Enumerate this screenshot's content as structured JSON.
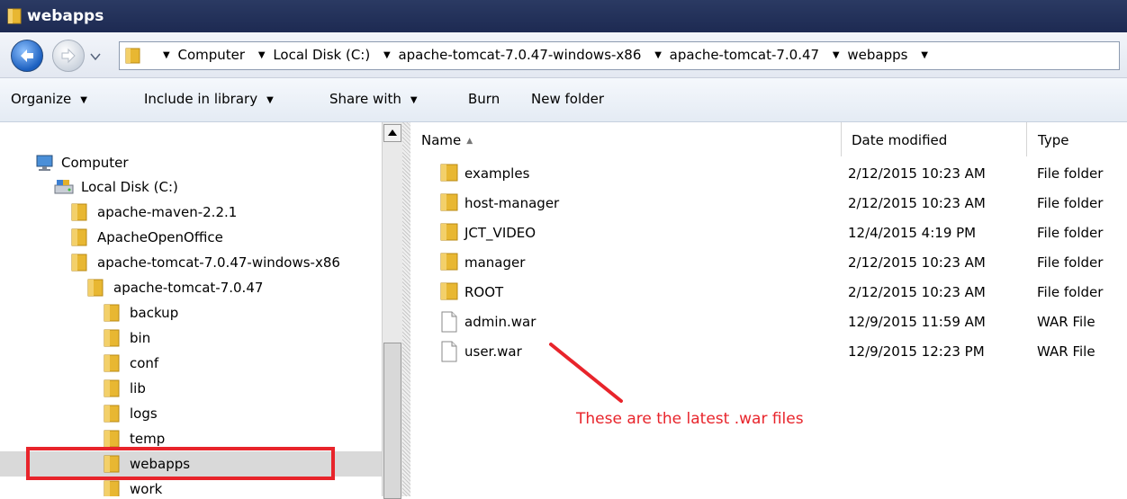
{
  "window": {
    "title": "webapps"
  },
  "address_bar": {
    "crumbs": [
      "Computer",
      "Local Disk (C:)",
      "apache-tomcat-7.0.47-windows-x86",
      "apache-tomcat-7.0.47",
      "webapps"
    ]
  },
  "toolbar": {
    "organize": "Organize",
    "include_in_library": "Include in library",
    "share_with": "Share with",
    "burn": "Burn",
    "new_folder": "New folder"
  },
  "tree": {
    "items": [
      {
        "label": "Computer",
        "icon": "computer-icon"
      },
      {
        "label": "Local Disk (C:)",
        "icon": "drive-icon"
      },
      {
        "label": "apache-maven-2.2.1",
        "icon": "folder-icon"
      },
      {
        "label": "ApacheOpenOffice",
        "icon": "folder-icon"
      },
      {
        "label": "apache-tomcat-7.0.47-windows-x86",
        "icon": "folder-icon"
      },
      {
        "label": "apache-tomcat-7.0.47",
        "icon": "folder-icon"
      },
      {
        "label": "backup",
        "icon": "folder-icon"
      },
      {
        "label": "bin",
        "icon": "folder-icon"
      },
      {
        "label": "conf",
        "icon": "folder-icon"
      },
      {
        "label": "lib",
        "icon": "folder-icon"
      },
      {
        "label": "logs",
        "icon": "folder-icon"
      },
      {
        "label": "temp",
        "icon": "folder-icon"
      },
      {
        "label": "webapps",
        "icon": "folder-icon",
        "selected": true
      },
      {
        "label": "work",
        "icon": "folder-icon"
      }
    ]
  },
  "columns": {
    "name": "Name",
    "date_modified": "Date modified",
    "type": "Type"
  },
  "files": [
    {
      "name": "examples",
      "date": "2/12/2015 10:23 AM",
      "type": "File folder",
      "icon": "folder-icon"
    },
    {
      "name": "host-manager",
      "date": "2/12/2015 10:23 AM",
      "type": "File folder",
      "icon": "folder-icon"
    },
    {
      "name": "JCT_VIDEO",
      "date": "12/4/2015 4:19 PM",
      "type": "File folder",
      "icon": "folder-icon"
    },
    {
      "name": "manager",
      "date": "2/12/2015 10:23 AM",
      "type": "File folder",
      "icon": "folder-icon"
    },
    {
      "name": "ROOT",
      "date": "2/12/2015 10:23 AM",
      "type": "File folder",
      "icon": "folder-icon"
    },
    {
      "name": "admin.war",
      "date": "12/9/2015 11:59 AM",
      "type": "WAR File",
      "icon": "file-icon"
    },
    {
      "name": "user.war",
      "date": "12/9/2015 12:23 PM",
      "type": "WAR File",
      "icon": "file-icon"
    }
  ],
  "annotation": {
    "text": "These are the latest .war files"
  },
  "colors": {
    "highlight_red": "#e8242b",
    "title_bar": "#1d2a52",
    "folder_yellow": "#e8b732"
  }
}
